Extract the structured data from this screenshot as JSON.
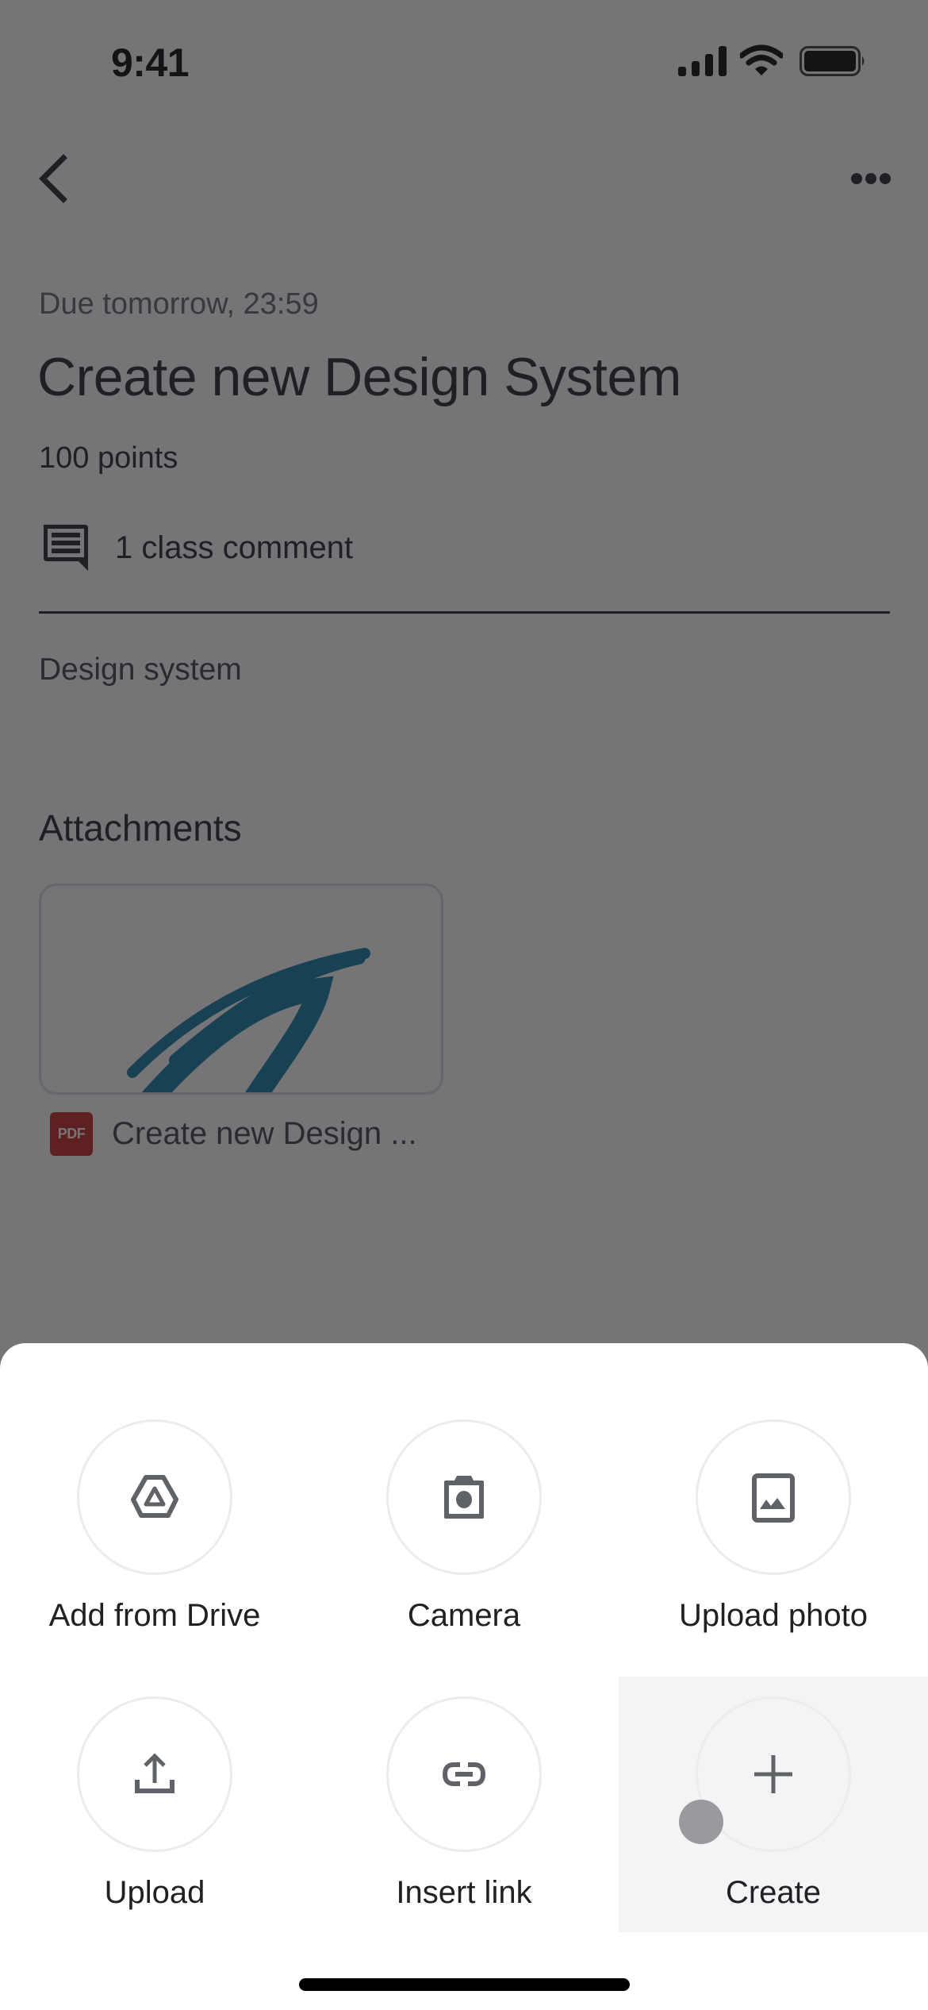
{
  "status_bar": {
    "time": "9:41",
    "icons": [
      "cellular-signal-icon",
      "wifi-icon",
      "battery-icon"
    ]
  },
  "nav": {
    "back_icon": "chevron-left-icon",
    "more_icon": "more-horizontal-icon"
  },
  "assignment": {
    "due": "Due tomorrow, 23:59",
    "title": "Create new Design System",
    "points": "100 points",
    "comments": "1 class comment",
    "description": "Design system"
  },
  "attachments": {
    "heading": "Attachments",
    "items": [
      {
        "type": "PDF",
        "badge": "PDF",
        "name": "Create new Design ...",
        "thumb_accent": "#0b7aa3",
        "badge_color": "#c5221f"
      }
    ]
  },
  "sheet": {
    "options": [
      {
        "label": "Add from Drive",
        "icon": "google-drive-icon"
      },
      {
        "label": "Camera",
        "icon": "camera-icon"
      },
      {
        "label": "Upload photo",
        "icon": "image-icon"
      },
      {
        "label": "Upload",
        "icon": "upload-icon"
      },
      {
        "label": "Insert link",
        "icon": "link-icon"
      },
      {
        "label": "Create",
        "icon": "plus-icon",
        "pressed": true
      }
    ]
  },
  "colors": {
    "icon_grey": "#5f6368",
    "scrim": "#747276",
    "pressed_bg": "#f4f3f5"
  }
}
